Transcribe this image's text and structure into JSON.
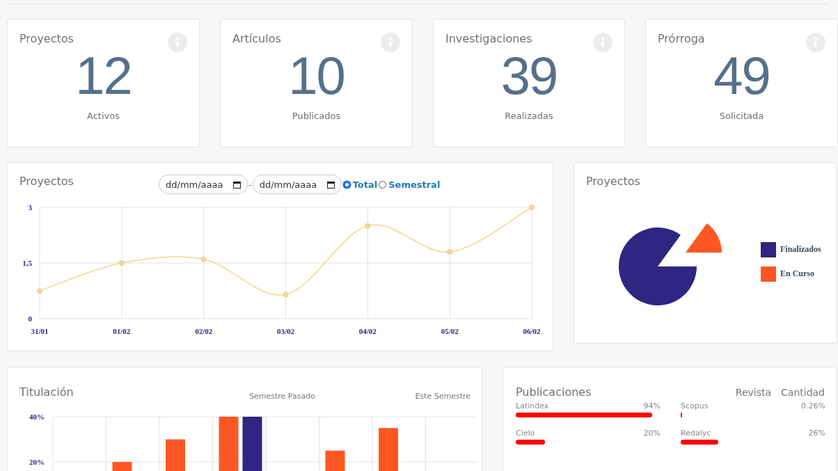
{
  "stats": [
    {
      "title": "Proyectos",
      "value": "12",
      "caption": "Activos"
    },
    {
      "title": "Artículos",
      "value": "10",
      "caption": "Publicados"
    },
    {
      "title": "Investigaciones",
      "value": "39",
      "caption": "Realizadas"
    },
    {
      "title": "Prórroga",
      "value": "49",
      "caption": "Solicitada"
    }
  ],
  "line_card": {
    "title": "Proyectos",
    "date_from": {
      "placeholder": "dd/mm/aaaa"
    },
    "separator": "-",
    "date_to": {
      "placeholder": "dd/mm/aaaa"
    },
    "modes": [
      {
        "label": "Total",
        "selected": true
      },
      {
        "label": "Semestral",
        "selected": false
      }
    ],
    "chart_data": {
      "type": "line",
      "x": [
        "31/01",
        "01/02",
        "02/02",
        "03/02",
        "04/02",
        "05/02",
        "06/02"
      ],
      "values": [
        0.75,
        1.5,
        1.6,
        0.65,
        2.5,
        1.8,
        3
      ],
      "ylim": [
        0,
        3
      ],
      "grid": true,
      "marker": true,
      "yticks": [
        {
          "value": 0,
          "label": "0"
        },
        {
          "value": 1.5,
          "label": "1,5"
        },
        {
          "value": 3,
          "label": "3"
        }
      ]
    }
  },
  "pie_card": {
    "title": "Proyectos",
    "legend": [
      {
        "label": "Finalizados",
        "color": "#2e2680"
      },
      {
        "label": "En Curso",
        "color": "#ff5722"
      }
    ]
  },
  "titulacion": {
    "title": "Titulación",
    "chart_data": {
      "type": "bar",
      "ylim": [
        0,
        40
      ],
      "yticks": [
        {
          "value": 40,
          "label": "40%"
        },
        {
          "value": 20,
          "label": "20%"
        }
      ],
      "series": [
        {
          "name": "Semestre Pasado",
          "color": "#ff5722",
          "values": [
            0,
            20,
            30,
            40,
            0,
            25,
            35,
            0
          ]
        },
        {
          "name": "Este Semestre",
          "color": "#2e2680",
          "values": [
            0,
            0,
            0,
            40,
            0,
            0,
            0,
            0
          ]
        }
      ]
    }
  },
  "publicaciones": {
    "title": "Publicaciones",
    "headers": [
      "Revista",
      "Cantidad"
    ],
    "items": [
      {
        "name": "Latindex",
        "reading": "94%"
      },
      {
        "name": "Scopus",
        "reading": "0.26%"
      },
      {
        "name": "Cielo",
        "reading": "20%"
      },
      {
        "name": "Redalyc",
        "reading": "26%"
      }
    ]
  }
}
